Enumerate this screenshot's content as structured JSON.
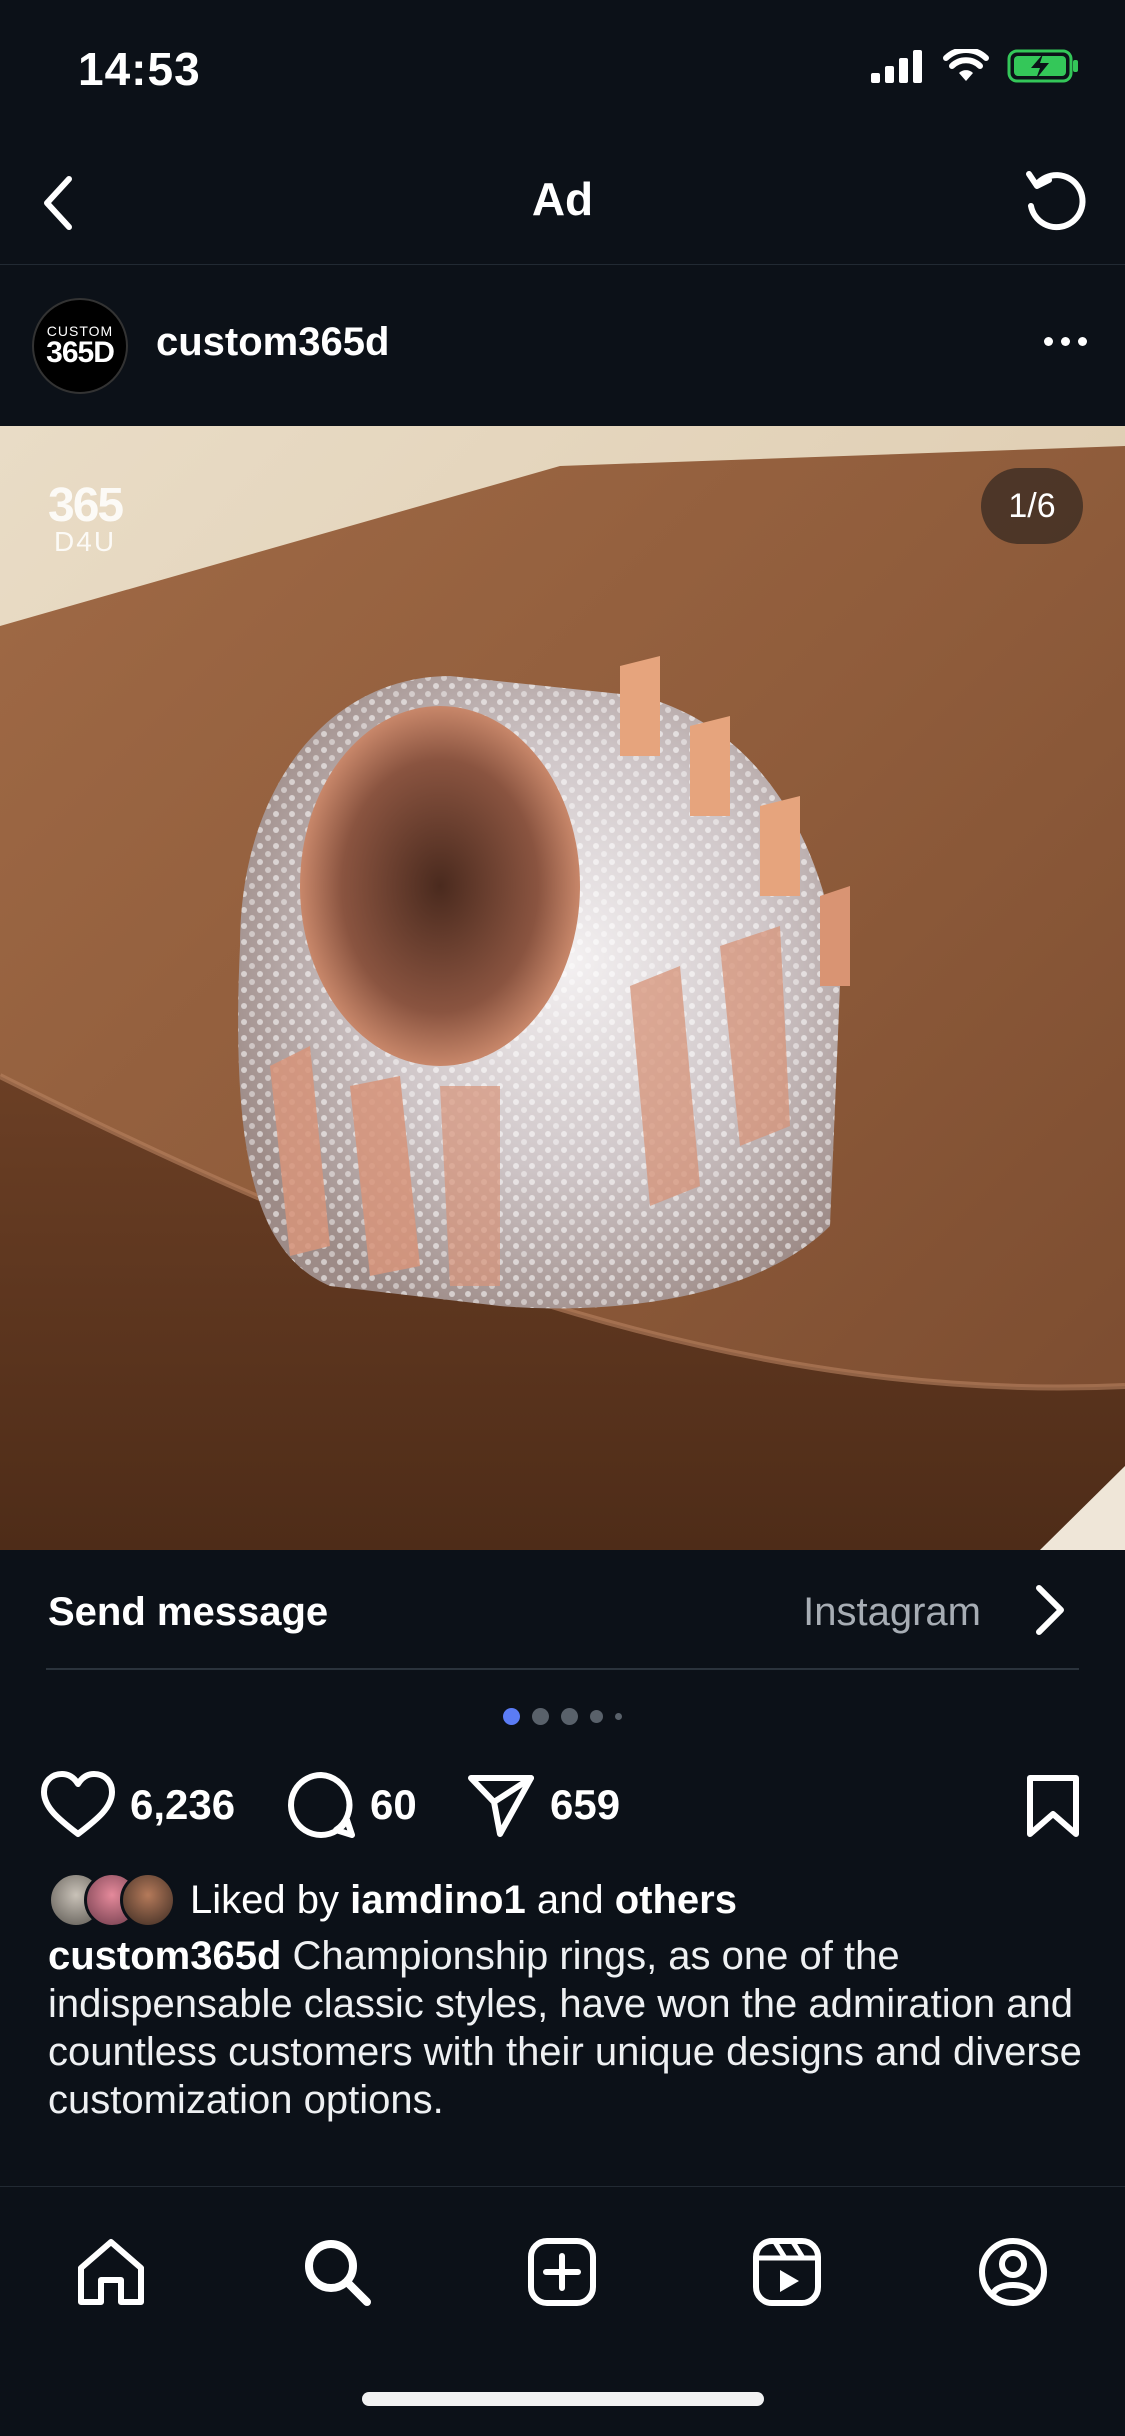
{
  "status_bar": {
    "time": "14:53",
    "battery_color": "#34c759"
  },
  "nav": {
    "title": "Ad",
    "back_icon": "chevron-left-icon",
    "refresh_icon": "refresh-icon"
  },
  "post": {
    "username": "custom365d",
    "avatar": {
      "line1": "CUSTOM",
      "line2": "365D"
    },
    "more_icon": "more-horizontal-icon"
  },
  "media": {
    "watermark_line1": "365",
    "watermark_line2": "D4U",
    "counter": "1/6"
  },
  "cta": {
    "label": "Send message",
    "source": "Instagram",
    "chevron_icon": "chevron-right-icon"
  },
  "carousel": {
    "total": 5,
    "active": 0,
    "accent": "#5b7cf5"
  },
  "actions": {
    "likes": "6,236",
    "comments": "60",
    "shares": "659"
  },
  "likes": {
    "prefix": "Liked by",
    "user": "iamdino1",
    "connector": "and",
    "others": "others"
  },
  "caption": {
    "username": "custom365d",
    "text": "Championship rings, as one of the indispensable classic styles, have won the admiration and countless customers with their unique designs and diverse customization options."
  },
  "tabbar": {
    "items": [
      {
        "icon": "home-icon"
      },
      {
        "icon": "search-icon"
      },
      {
        "icon": "create-icon"
      },
      {
        "icon": "reels-icon"
      },
      {
        "icon": "profile-icon"
      }
    ]
  }
}
